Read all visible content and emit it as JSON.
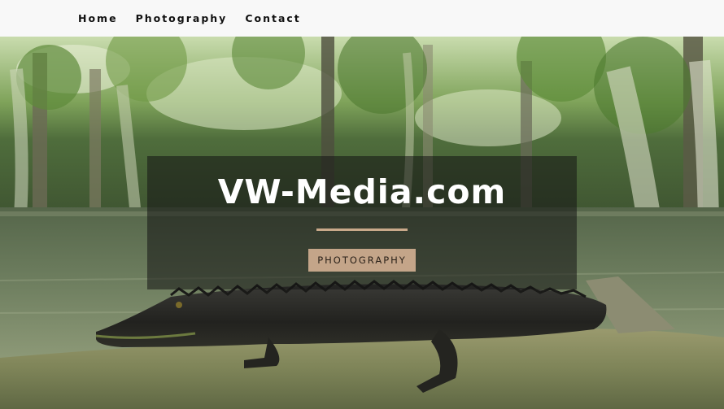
{
  "nav": {
    "items": [
      {
        "label": "Home"
      },
      {
        "label": "Photography"
      },
      {
        "label": "Contact"
      }
    ]
  },
  "hero": {
    "title": "VW-Media.com",
    "button_label": "PHOTOGRAPHY",
    "background_subject": "alligator-swamp-photo"
  },
  "colors": {
    "navbar_bg": "#f8f8f8",
    "accent": "#c4a589",
    "overlay": "rgba(20,20,20,0.55)"
  }
}
